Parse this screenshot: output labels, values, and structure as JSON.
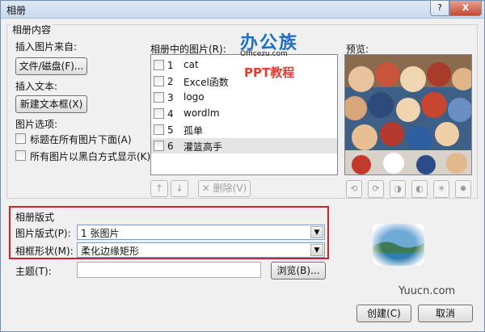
{
  "title": "相册",
  "titlebar": {
    "help": "?",
    "close": "X"
  },
  "content_group": {
    "legend": "相册内容",
    "insert_picture_from": "插入图片来自:",
    "file_disk_button": "文件/磁盘(F)...",
    "insert_text": "插入文本:",
    "new_textbox_button": "新建文本框(X)",
    "picture_options": "图片选项:",
    "options": [
      {
        "label": "标题在所有图片下面(A)",
        "checked": false
      },
      {
        "label": "所有图片以黑白方式显示(K)",
        "checked": false
      }
    ],
    "list_label": "相册中的图片(R):",
    "pictures": [
      {
        "num": "1",
        "name": "cat",
        "checked": false,
        "selected": false
      },
      {
        "num": "2",
        "name": "Excel函数",
        "checked": false,
        "selected": false
      },
      {
        "num": "3",
        "name": "logo",
        "checked": false,
        "selected": false
      },
      {
        "num": "4",
        "name": "wordlm",
        "checked": false,
        "selected": false
      },
      {
        "num": "5",
        "name": "孤单",
        "checked": false,
        "selected": false
      },
      {
        "num": "6",
        "name": "灌篮高手",
        "checked": false,
        "selected": true
      }
    ],
    "up_icon": "arrow-up",
    "down_icon": "arrow-down",
    "delete_button": "删除(V)",
    "preview_label": "预览:",
    "image_buttons": [
      "rotate-left",
      "rotate-right",
      "contrast-up",
      "contrast-down",
      "brightness-up",
      "brightness-down"
    ]
  },
  "layout_group": {
    "legend": "相册版式",
    "picture_layout_label": "图片版式(P):",
    "picture_layout_value": "1 张图片",
    "frame_shape_label": "相框形状(M):",
    "frame_shape_value": "柔化边缘矩形",
    "theme_label": "主题(T):",
    "theme_value": "",
    "browse_button": "浏览(B)..."
  },
  "watermark": {
    "brand": "办公族",
    "url": "Officezu.com",
    "subtitle": "PPT教程",
    "corner": "Yuucn.com"
  },
  "footer": {
    "create_button": "创建(C)",
    "cancel_button": "取消"
  },
  "colors": {
    "highlight_box": "#d0232f",
    "brand_blue": "#1f6fc7",
    "brand_red": "#e23c2e"
  }
}
